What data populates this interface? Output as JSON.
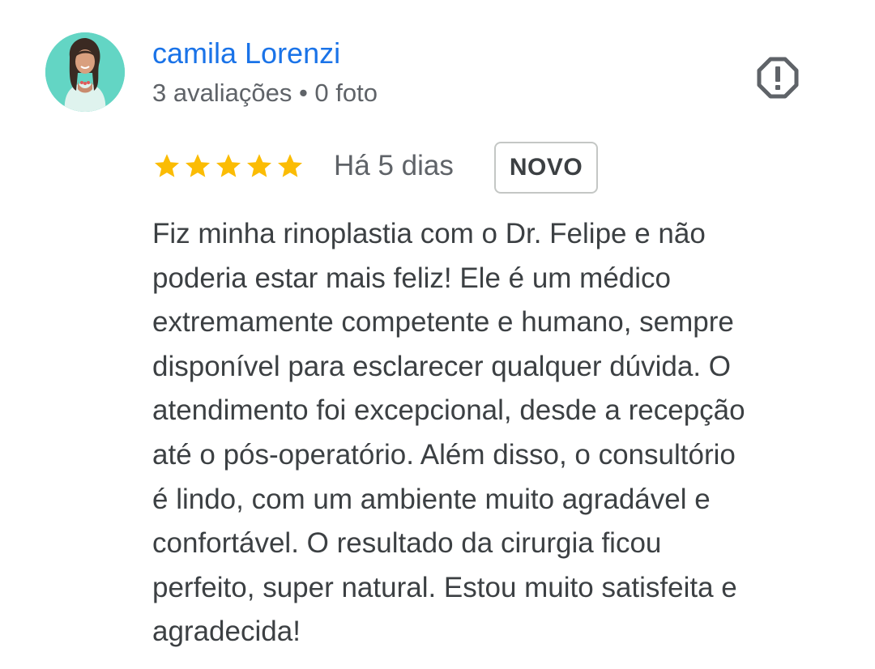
{
  "review": {
    "reviewer_name": "camila Lorenzi",
    "reviewer_meta": "3 avaliações • 0 foto",
    "rating": 5,
    "rating_max": 5,
    "date": "Há 5 dias",
    "badge": "NOVO",
    "text_lines": [
      "Fiz minha rinoplastia com o Dr. Felipe e não",
      "poderia estar mais feliz! Ele é um médico",
      "extremamente competente e humano, sempre",
      "disponível para esclarecer qualquer dúvida. O",
      "atendimento foi excepcional, desde a recepção",
      "até o pós-operatório. Além disso, o consultório",
      "é lindo, com um ambiente muito agradável e",
      "confortável. O resultado da cirurgia ficou",
      "perfeito, super natural. Estou muito satisfeita e",
      "agradecida!"
    ]
  },
  "icons": {
    "avatar": "profile-photo",
    "report": "report-octagon-icon",
    "star": "star-icon"
  },
  "colors": {
    "name_link": "#1a73e8",
    "star": "#fbbc04",
    "secondary_text": "#5f6368",
    "body_text": "#3c4043",
    "icon": "#5f6368"
  }
}
